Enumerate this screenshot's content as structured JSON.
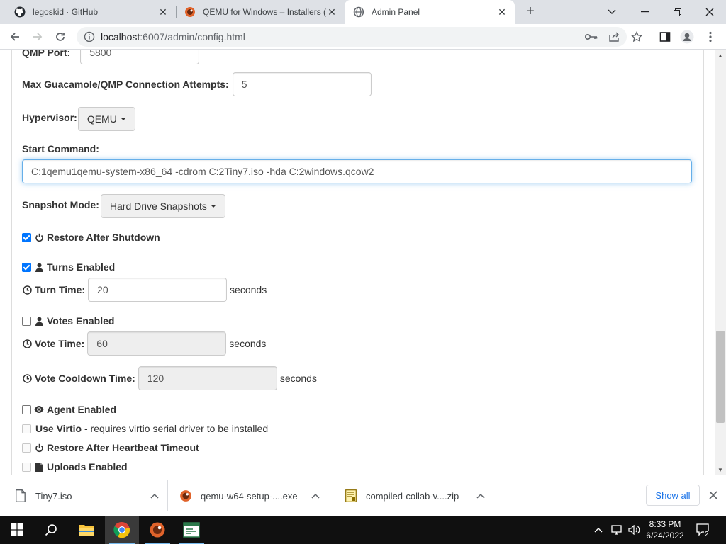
{
  "browser": {
    "tabs": [
      {
        "title": "legoskid · GitHub",
        "favicon": "github-icon",
        "active": false
      },
      {
        "title": "QEMU for Windows – Installers (6",
        "favicon": "qemu-icon",
        "active": false
      },
      {
        "title": "Admin Panel",
        "favicon": "globe-icon",
        "active": true
      }
    ],
    "url_host": "localhost",
    "url_rest": ":6007/admin/config.html"
  },
  "form": {
    "qmp_port_label": "QMP Port:",
    "qmp_port_value": "5800",
    "max_attempts_label": "Max Guacamole/QMP Connection Attempts:",
    "max_attempts_value": "5",
    "hypervisor_label": "Hypervisor:",
    "hypervisor_value": "QEMU",
    "start_command_label": "Start Command:",
    "start_command_value": "C:1qemu1qemu-system-x86_64 -cdrom C:2Tiny7.iso -hda C:2windows.qcow2",
    "snapshot_label": "Snapshot Mode:",
    "snapshot_value": "Hard Drive Snapshots",
    "restore_after_shutdown_label": "Restore After Shutdown",
    "restore_after_shutdown_checked": true,
    "turns_enabled_label": "Turns Enabled",
    "turns_enabled_checked": true,
    "turn_time_label": "Turn Time:",
    "turn_time_value": "20",
    "votes_enabled_label": "Votes Enabled",
    "votes_enabled_checked": false,
    "vote_time_label": "Vote Time:",
    "vote_time_value": "60",
    "vote_cooldown_label": "Vote Cooldown Time:",
    "vote_cooldown_value": "120",
    "seconds_unit": "seconds",
    "agent_enabled_label": "Agent Enabled",
    "agent_enabled_checked": false,
    "use_virtio_label": "Use Virtio",
    "use_virtio_note": " - requires virtio serial driver to be installed",
    "restore_heartbeat_label": "Restore After Heartbeat Timeout",
    "uploads_enabled_label": "Uploads Enabled"
  },
  "downloads": {
    "items": [
      {
        "name": "Tiny7.iso",
        "icon": "file-icon"
      },
      {
        "name": "qemu-w64-setup-....exe",
        "icon": "qemu-icon"
      },
      {
        "name": "compiled-collab-v....zip",
        "icon": "zip-icon"
      }
    ],
    "show_all": "Show all"
  },
  "taskbar": {
    "time": "8:33 PM",
    "date": "6/24/2022",
    "notifications": "2"
  },
  "colors": {
    "accent": "#0075ff",
    "focus_border": "#66afe9",
    "link": "#1a73e8"
  }
}
